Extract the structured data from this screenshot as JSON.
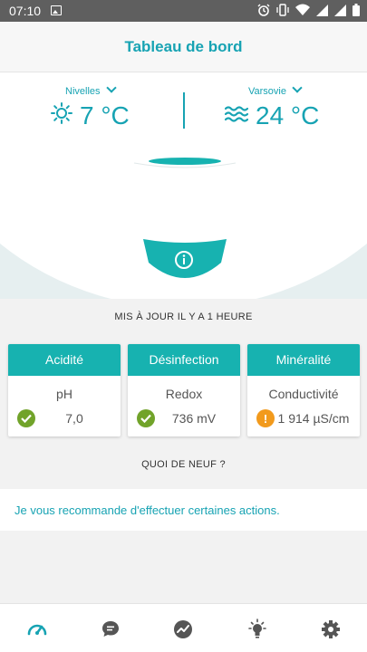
{
  "status_bar": {
    "time": "07:10",
    "icons": [
      "image-icon",
      "alarm-icon",
      "vibrate-icon",
      "wifi-icon",
      "signal-icon",
      "signal-icon",
      "battery-icon"
    ]
  },
  "header": {
    "title": "Tableau de bord"
  },
  "weather": {
    "left": {
      "city": "Nivelles",
      "temperature": "7 °C",
      "icon": "sun-icon"
    },
    "right": {
      "city": "Varsovie",
      "temperature": "24 °C",
      "icon": "water-waves-icon"
    }
  },
  "device": {
    "info_icon": "info-icon"
  },
  "updated_text": "MIS À JOUR IL Y A 1 HEURE",
  "cards": [
    {
      "title": "Acidité",
      "metric": "pH",
      "value": "7,0",
      "status": "ok",
      "icon": "check-icon"
    },
    {
      "title": "Désinfection",
      "metric": "Redox",
      "value": "736 mV",
      "status": "ok",
      "icon": "check-icon"
    },
    {
      "title": "Minéralité",
      "metric": "Conductivité",
      "value": "1 914 µS/cm",
      "status": "warning",
      "icon": "exclamation-icon"
    }
  ],
  "news_heading": "QUOI DE NEUF ?",
  "recommendation": "Je vous recommande d'effectuer certaines actions.",
  "bottom_nav": [
    {
      "name": "dashboard",
      "icon": "gauge-icon",
      "active": true
    },
    {
      "name": "messages",
      "icon": "chat-bubble-icon",
      "active": false
    },
    {
      "name": "history",
      "icon": "trend-chart-icon",
      "active": false
    },
    {
      "name": "tips",
      "icon": "lightbulb-icon",
      "active": false
    },
    {
      "name": "settings",
      "icon": "gear-icon",
      "active": false
    }
  ],
  "colors": {
    "accent": "#17a3b3",
    "card_header": "#17b2b0",
    "ok": "#71a32a",
    "warning": "#f29a1c"
  }
}
